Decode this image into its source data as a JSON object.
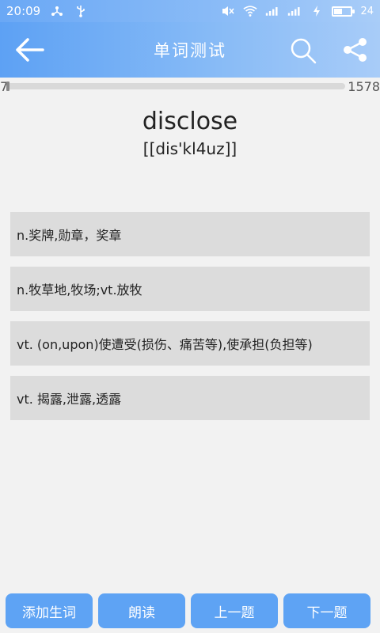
{
  "status_bar": {
    "time": "20:09",
    "battery_level": "24",
    "icons": [
      "usb-tether-icon",
      "usb-icon",
      "mute-icon",
      "wifi-icon",
      "signal-4g-icon",
      "signal-icon",
      "charging-icon",
      "battery-icon"
    ]
  },
  "app_bar": {
    "title": "单词测试",
    "icons": [
      "back-arrow-icon",
      "search-icon",
      "share-icon"
    ]
  },
  "progress": {
    "current": "7",
    "total": "1578",
    "fraction": 0.0044
  },
  "question": {
    "word": "disclose",
    "phonetic": "[[dis'kl4uz]]"
  },
  "options": [
    {
      "label": "n.奖牌,勋章，奖章"
    },
    {
      "label": "n.牧草地,牧场;vt.放牧"
    },
    {
      "label": "vt. (on,upon)使遭受(损伤、痛苦等),使承担(负担等)"
    },
    {
      "label": "vt. 揭露,泄露,透露"
    }
  ],
  "bottom_buttons": {
    "add_word": "添加生词",
    "read_aloud": "朗读",
    "previous": "上一题",
    "next": "下一题"
  },
  "colors": {
    "accent": "#5ea3f4",
    "option_bg": "#dcdcdc",
    "page_bg": "#f2f2f2"
  }
}
